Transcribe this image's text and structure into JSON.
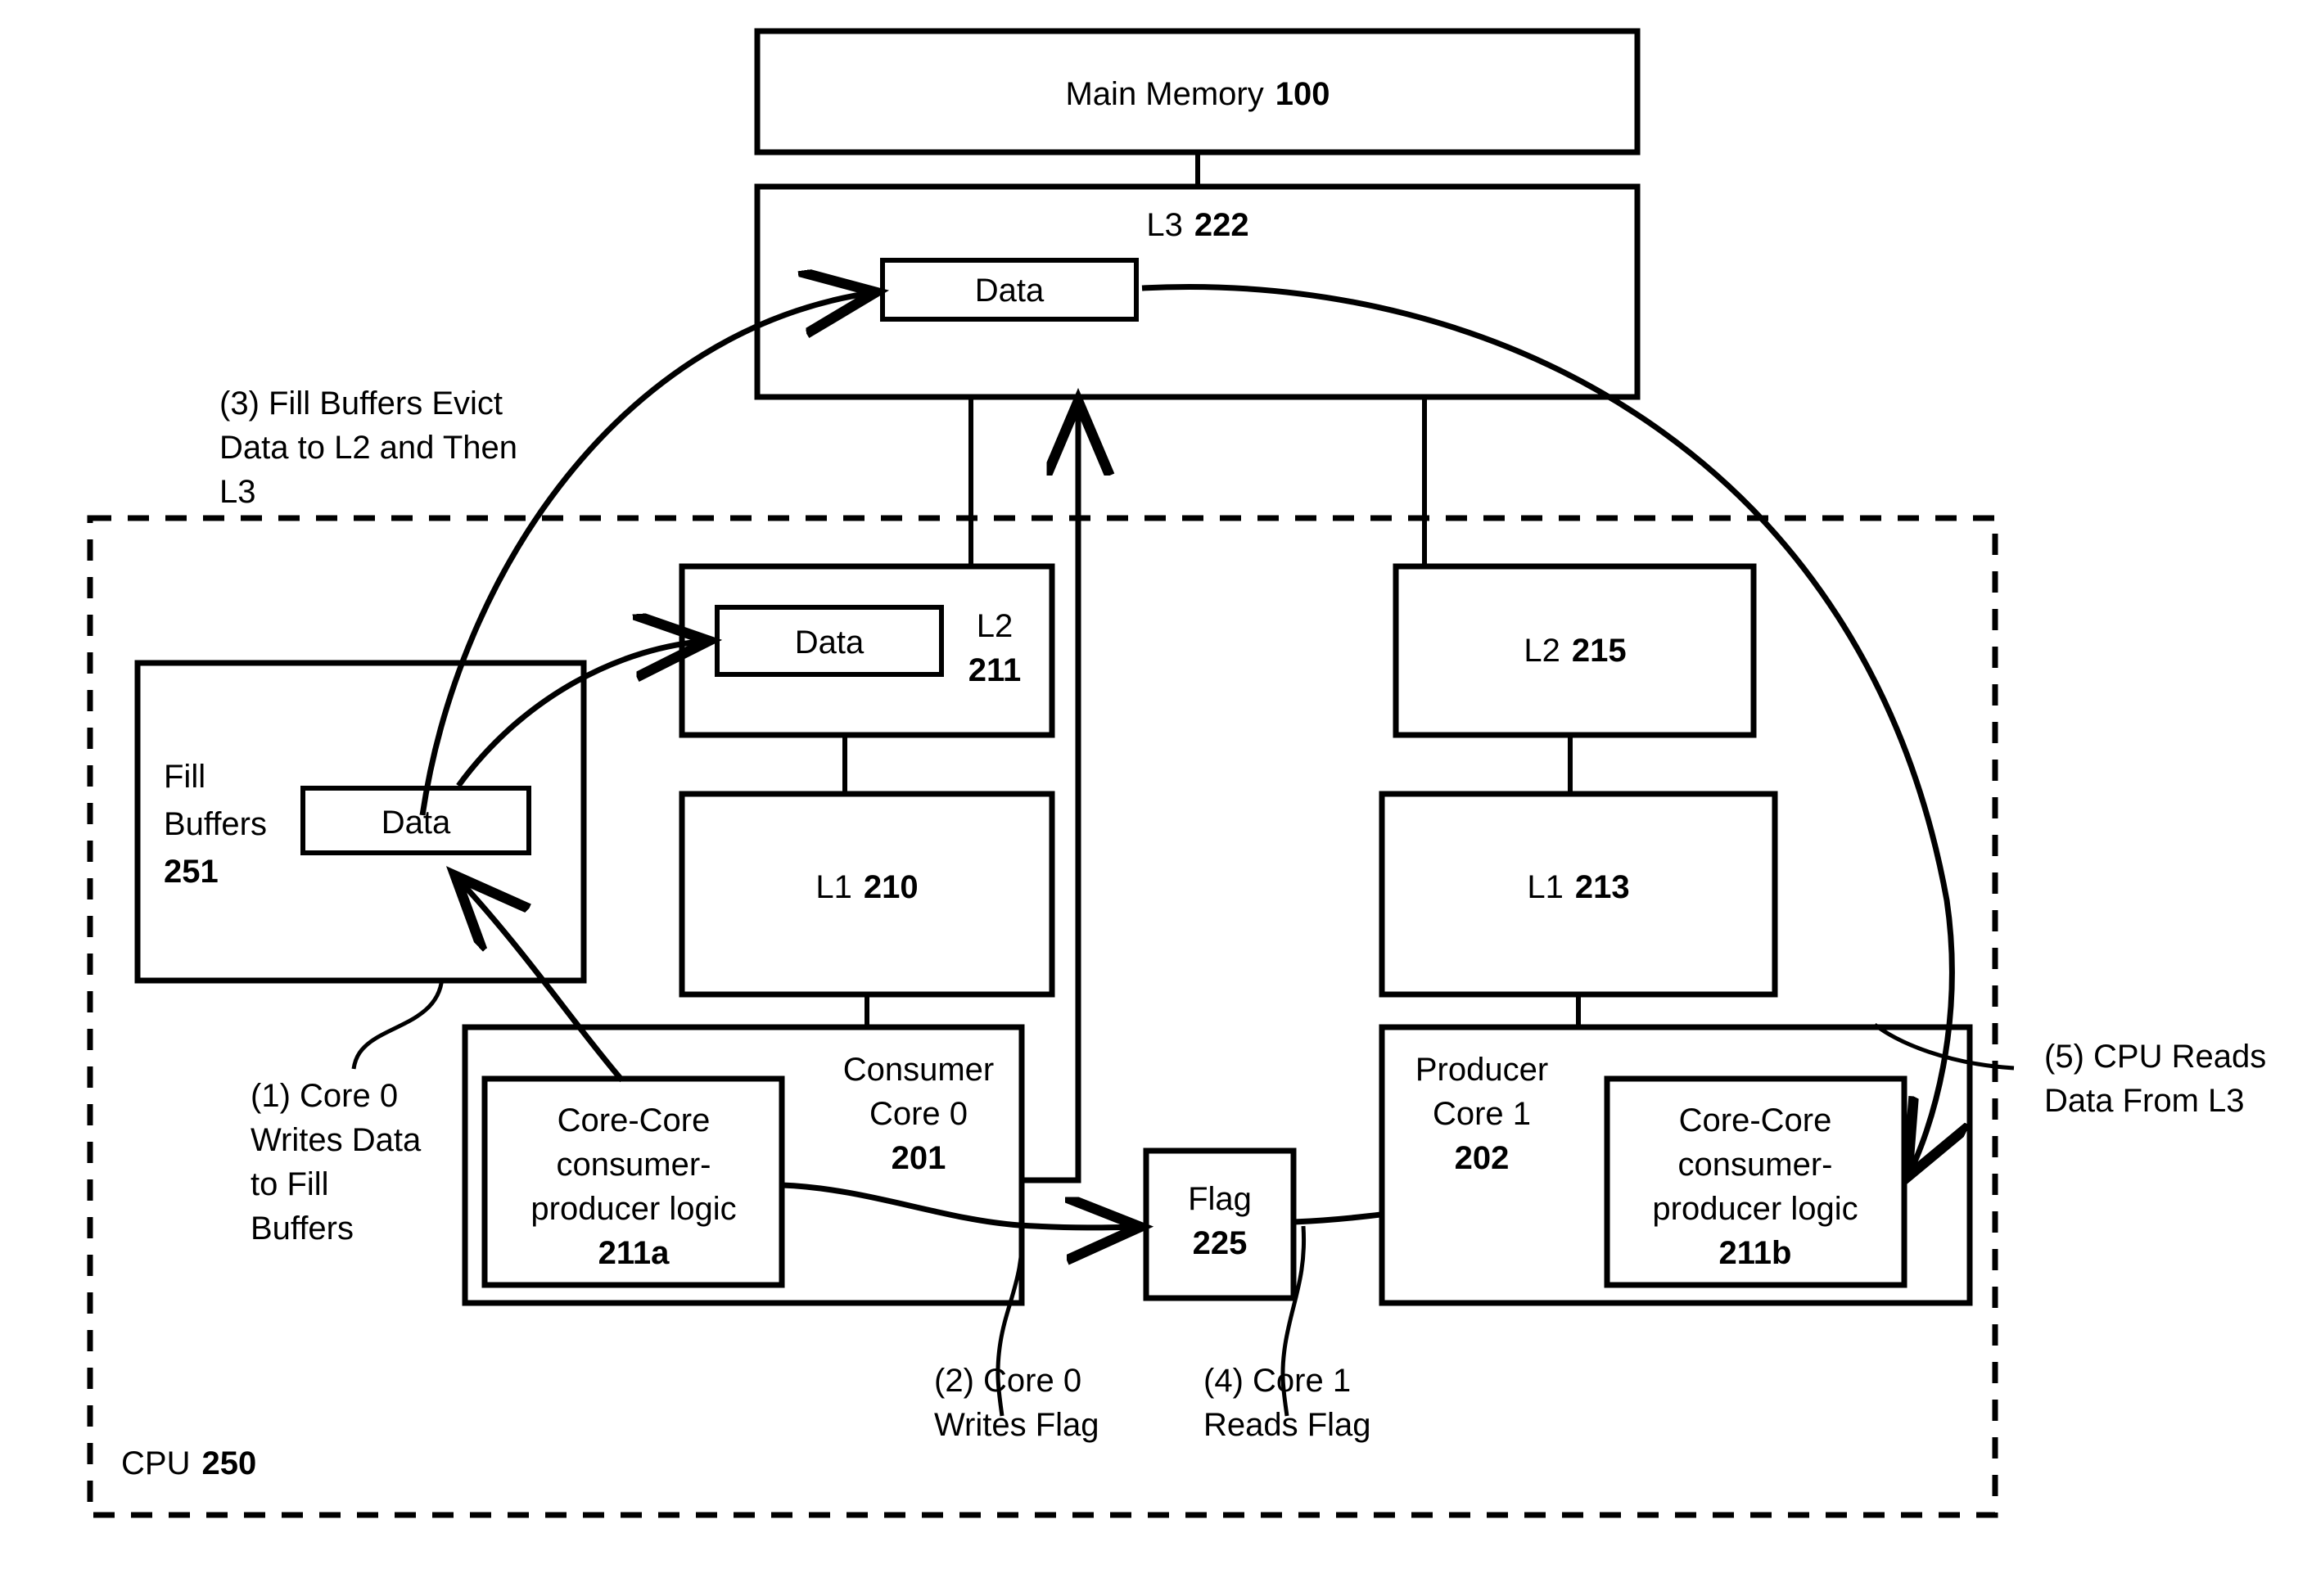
{
  "figure": {
    "title": "Processor cache hierarchy core-to-core data transfer diagram"
  },
  "blocks": {
    "main_memory": {
      "label": "Main Memory",
      "ref": "100"
    },
    "l3": {
      "label": "L3",
      "ref": "222"
    },
    "l3_data": {
      "label": "Data"
    },
    "fill_buffers": {
      "label_line1": "Fill",
      "label_line2": "Buffers",
      "ref": "251"
    },
    "fill_buffers_data": {
      "label": "Data"
    },
    "l2_consumer": {
      "label": "L2",
      "ref": "211"
    },
    "l2_consumer_data": {
      "label": "Data"
    },
    "l1_consumer": {
      "label": "L1",
      "ref": "210"
    },
    "consumer_core": {
      "label_line1": "Consumer",
      "label_line2": "Core 0",
      "ref": "201"
    },
    "cc_logic_a": {
      "line1": "Core-Core",
      "line2": "consumer-",
      "line3": "producer logic",
      "ref": "211a"
    },
    "flag": {
      "label": "Flag",
      "ref": "225"
    },
    "l2_producer": {
      "label": "L2",
      "ref": "215"
    },
    "l1_producer": {
      "label": "L1",
      "ref": "213"
    },
    "producer_core": {
      "label_line1": "Producer",
      "label_line2": "Core 1",
      "ref": "202"
    },
    "cc_logic_b": {
      "line1": "Core-Core",
      "line2": "consumer-",
      "line3": "producer logic",
      "ref": "211b"
    },
    "cpu": {
      "label": "CPU",
      "ref": "250"
    }
  },
  "steps": {
    "step1": {
      "line1": "(1) Core 0",
      "line2": "Writes Data",
      "line3": "to Fill",
      "line4": "Buffers"
    },
    "step2": {
      "line1": "(2) Core 0",
      "line2": "Writes Flag"
    },
    "step3": {
      "line1": "(3) Fill Buffers Evict",
      "line2": "Data to L2 and Then",
      "line3": "L3"
    },
    "step4": {
      "line1": "(4) Core 1",
      "line2": "Reads Flag"
    },
    "step5": {
      "line1": "(5) CPU Reads",
      "line2": "Data From L3"
    }
  },
  "colors": {
    "stroke": "#000000",
    "fill": "#ffffff"
  }
}
